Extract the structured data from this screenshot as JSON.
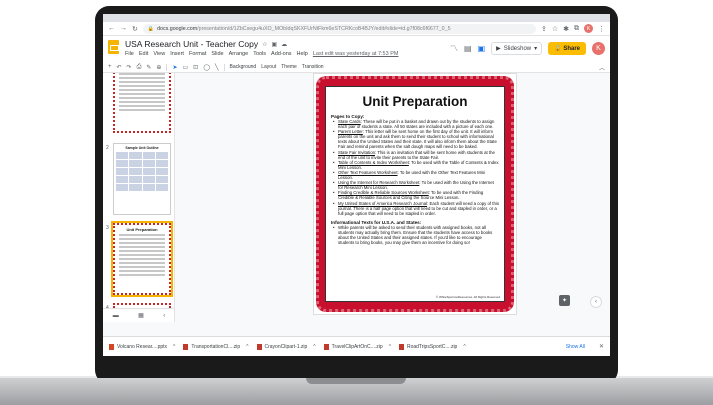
{
  "browser": {
    "url_host": "docs.google.com",
    "url_path": "/presentation/d/1ZbCsegu4uXO_MObIdqSKXFUrNtFkm6eSTCRKcoB4BJY/edit#slide=id.g7f08c6f6677_0_5"
  },
  "app": {
    "title": "USA Research Unit - Teacher Copy",
    "menus": [
      "File",
      "Edit",
      "View",
      "Insert",
      "Format",
      "Slide",
      "Arrange",
      "Tools",
      "Add-ons",
      "Help"
    ],
    "last_edit": "Last edit was yesterday at 7:53 PM",
    "slideshow_label": "Slideshow",
    "share_label": "Share",
    "avatar_letter": "K"
  },
  "toolbar": {
    "background_label": "Background",
    "layout_label": "Layout",
    "theme_label": "Theme",
    "transition_label": "Transition"
  },
  "filmstrip": {
    "slides": [
      {
        "num": "",
        "title": ""
      },
      {
        "num": "2",
        "title": "Sample Unit Outline"
      },
      {
        "num": "3",
        "title": "Unit Preparation"
      },
      {
        "num": "4",
        "title": ""
      }
    ]
  },
  "slide": {
    "title": "Unit Preparation",
    "section1": "Pages to Copy:",
    "items": [
      {
        "link": "State Cards",
        "text": ": These will be put in a basket and drawn out by the students to assign each pair of students a state. All 50 states are included with a picture of each one."
      },
      {
        "link": "Parent Letter",
        "text": ": This letter will be sent home on the first day of the unit. It will inform parents on the unit and ask them to send their student to school with informational texts about the United States and their state. It will also inform them about the State Fair and remind parents when the salt dough maps will need to be baked."
      },
      {
        "link": "State Fair Invitation",
        "text": ": This is an invitation that will be sent home with students at the end of the unit to invite their parents to the State Fair."
      },
      {
        "link": "Table of Contents & Index Worksheet",
        "text": ": To be used with the Table of Contents & Index Mini Lesson."
      },
      {
        "link": "Other Text Features Worksheet",
        "text": ": To be used with the Other Text Features Mini Lesson."
      },
      {
        "link": "Using the Internet for Research Worksheet",
        "text": ": To be used with the Using the Internet for Research Mini Lesson."
      },
      {
        "link": "Finding Credible & Reliable Sources Worksheet",
        "text": ": To be used with the Finding Credible & Reliable Sources and Citing the Source Mini Lesson."
      },
      {
        "link": "My United States of America Research Journal",
        "text": ": Each student will need a copy of this journal. There is a half page option that will need to be cut and stapled in order, or a full page option that will need to be stapled in order."
      }
    ],
    "section2": "Informational Texts for U.S.A. and States:",
    "items2": [
      "While parents will be asked to send their students with assigned books, not all students may actually bring them. Ensure that the students have access to books about the United States and their assigned states. If you'd like to encourage students to bring books, you may give them an incentive for doing so!"
    ],
    "copyright": "© WhiteSparrowResources, All Rights Reserved"
  },
  "downloads": {
    "items": [
      "Volcano Resear....pptx",
      "TransportationCl....zip",
      "CrayonClipart-1.zip",
      "TravelClipArtOnC....zip",
      "RoadTripsSportC....zip"
    ],
    "show_all": "Show All"
  },
  "colors": {
    "frame_red": "#c8102e",
    "share_yellow": "#fbbc04",
    "avatar": "#e8716b"
  }
}
